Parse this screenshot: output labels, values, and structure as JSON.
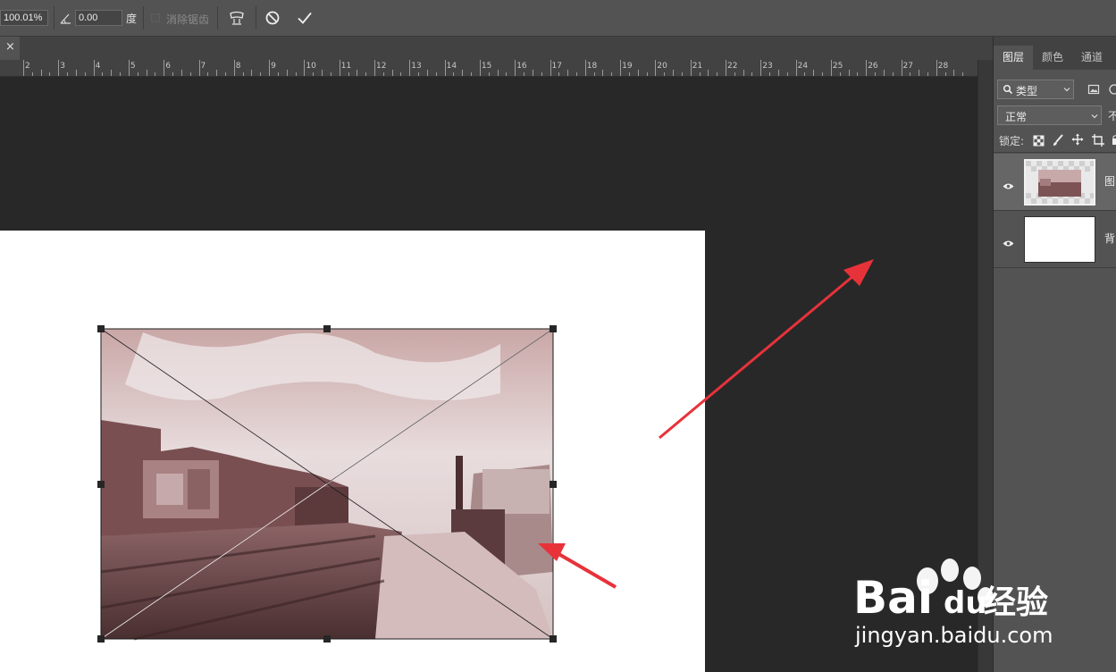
{
  "options_bar": {
    "zoom_value": "100.01%",
    "angle_value": "0.00",
    "angle_unit": "度",
    "antialias_label": "消除锯齿"
  },
  "document_tab": {
    "close_glyph": "×"
  },
  "ruler": {
    "numbers": [
      "2",
      "3",
      "4",
      "5",
      "6",
      "7",
      "8",
      "9",
      "10",
      "11",
      "12",
      "13",
      "14",
      "15",
      "16",
      "17",
      "18",
      "19",
      "20",
      "21",
      "22",
      "23",
      "24",
      "25",
      "26",
      "27",
      "28"
    ]
  },
  "layers_panel": {
    "tabs": [
      {
        "label": "图层",
        "active": true
      },
      {
        "label": "颜色",
        "active": false
      },
      {
        "label": "通道",
        "active": false
      }
    ],
    "filter_label": "类型",
    "blend_mode": "正常",
    "opacity_label_fragment": "不",
    "lock_label": "锁定:",
    "layers": [
      {
        "name_fragment": "图",
        "selected": true
      },
      {
        "name_fragment": "背",
        "selected": false
      }
    ]
  },
  "watermark": {
    "brand_text": "Bai",
    "brand_text2": "du",
    "brand_suffix": "经验",
    "url": "jingyan.baidu.com"
  },
  "colors": {
    "annotation_arrow": "#e8323a",
    "ui_dark": "#282828",
    "panel": "#535353"
  }
}
